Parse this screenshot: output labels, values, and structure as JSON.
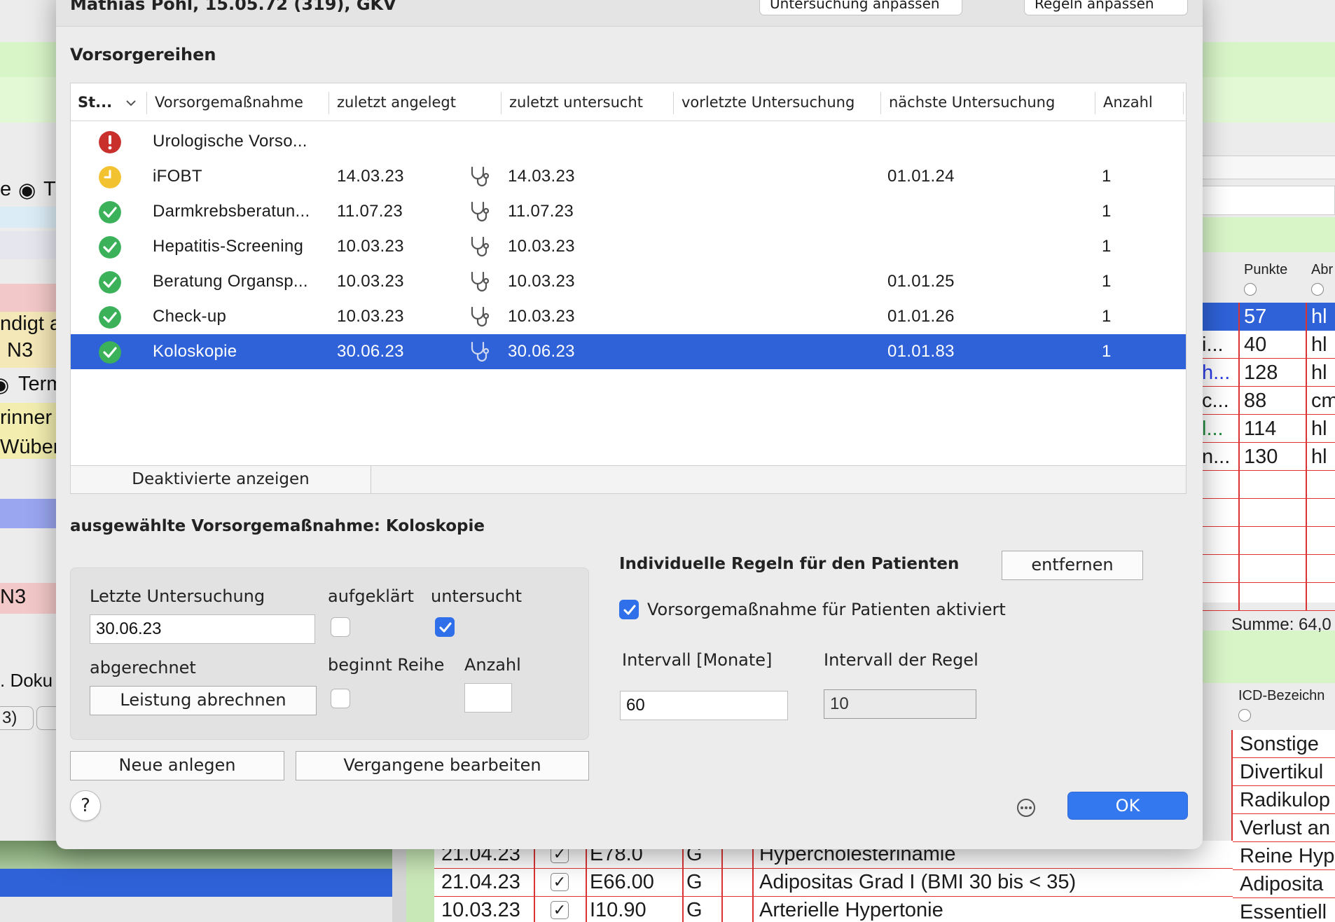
{
  "dialog": {
    "title": "Mathias Pohl, 15.05.72 (319), GKV",
    "section_title": "Vorsorgereihen",
    "top_buttons": [
      "Untersuchung anpassen",
      "Regeln anpassen"
    ]
  },
  "table": {
    "columns": [
      "St...",
      "Vorsorgemaßnahme",
      "zuletzt angelegt",
      "zuletzt untersucht",
      "vorletzte Untersuchung",
      "nächste Untersuchung",
      "Anzahl"
    ],
    "rows": [
      {
        "status": "error",
        "name": "Urologische Vorso...",
        "angelegt": "",
        "untersucht": "",
        "vorletzte": "",
        "naechste": "",
        "anzahl": "",
        "steth": false
      },
      {
        "status": "pending",
        "name": "iFOBT",
        "angelegt": "14.03.23",
        "untersucht": "14.03.23",
        "vorletzte": "",
        "naechste": "01.01.24",
        "anzahl": "1",
        "steth": true
      },
      {
        "status": "ok",
        "name": "Darmkrebsberatun...",
        "angelegt": "11.07.23",
        "untersucht": "11.07.23",
        "vorletzte": "",
        "naechste": "",
        "anzahl": "1",
        "steth": true
      },
      {
        "status": "ok",
        "name": "Hepatitis-Screening",
        "angelegt": "10.03.23",
        "untersucht": "10.03.23",
        "vorletzte": "",
        "naechste": "",
        "anzahl": "1",
        "steth": true
      },
      {
        "status": "ok",
        "name": "Beratung Organsp...",
        "angelegt": "10.03.23",
        "untersucht": "10.03.23",
        "vorletzte": "",
        "naechste": "01.01.25",
        "anzahl": "1",
        "steth": true
      },
      {
        "status": "ok",
        "name": "Check-up",
        "angelegt": "10.03.23",
        "untersucht": "10.03.23",
        "vorletzte": "",
        "naechste": "01.01.26",
        "anzahl": "1",
        "steth": true
      },
      {
        "status": "ok",
        "name": "Koloskopie",
        "angelegt": "30.06.23",
        "untersucht": "30.06.23",
        "vorletzte": "",
        "naechste": "01.01.83",
        "anzahl": "1",
        "steth": true,
        "selected": true
      }
    ],
    "deactivated_button": "Deaktivierte anzeigen"
  },
  "selected": {
    "title": "ausgewählte Vorsorgemaßnahme: Koloskopie",
    "last_exam_label": "Letzte Untersuchung",
    "last_exam_value": "30.06.23",
    "aufgeklaert_label": "aufgeklärt",
    "aufgeklaert": false,
    "untersucht_label": "untersucht",
    "untersucht": true,
    "abgerechnet_label": "abgerechnet",
    "leistung_button": "Leistung abrechnen",
    "beginnt_reihe_label": "beginnt Reihe",
    "beginnt_reihe": false,
    "anzahl_label": "Anzahl",
    "anzahl_value": "",
    "neue_button": "Neue anlegen",
    "vergangene_button": "Vergangene bearbeiten"
  },
  "rules": {
    "title": "Individuelle Regeln für den Patienten",
    "remove_button": "entfernen",
    "activated_label": "Vorsorgemaßnahme für Patienten aktiviert",
    "activated": true,
    "interval_label": "Intervall [Monate]",
    "interval_value": "60",
    "rule_interval_label": "Intervall der Regel",
    "rule_interval_value": "10"
  },
  "footer": {
    "help": "?",
    "ok": "OK"
  },
  "background": {
    "left_texts": [
      "e",
      "T",
      "ndigt a",
      "N3",
      "Term",
      "rinner",
      "Wüber",
      "N3",
      ". Doku",
      "3)"
    ],
    "right_header": [
      "Punkte",
      "Abr"
    ],
    "right_rows": [
      {
        "a": "",
        "b": "57",
        "c": "hl"
      },
      {
        "a": "i...",
        "b": "40",
        "c": "hl"
      },
      {
        "a": "h...",
        "b": "128",
        "c": "hl"
      },
      {
        "a": "c...",
        "b": "88",
        "c": "cm"
      },
      {
        "a": "l...",
        "b": "114",
        "c": "hl"
      },
      {
        "a": "n...",
        "b": "130",
        "c": "hl"
      }
    ],
    "summe": "Summe: 64,0",
    "icd_header": "ICD-Bezeichn",
    "icd_rows": [
      "Sonstige",
      "Divertikul",
      "Radikulop",
      "Verlust an",
      "Reine Hyp",
      "Adiposita",
      "Essentiell"
    ],
    "bottom_rows": [
      {
        "date": "21.04.23",
        "code": "E78.0",
        "g": "G",
        "text": "Hypercholesterinämie"
      },
      {
        "date": "21.04.23",
        "code": "E66.00",
        "g": "G",
        "text": "Adipositas Grad I (BMI 30 bis < 35)"
      },
      {
        "date": "10.03.23",
        "code": "I10.90",
        "g": "G",
        "text": "Arterielle Hypertonie"
      }
    ]
  },
  "colors": {
    "selection": "#2f62d8",
    "accent": "#3478f0",
    "error": "#c9302c",
    "pending": "#f2c230",
    "ok": "#3bb25a"
  }
}
